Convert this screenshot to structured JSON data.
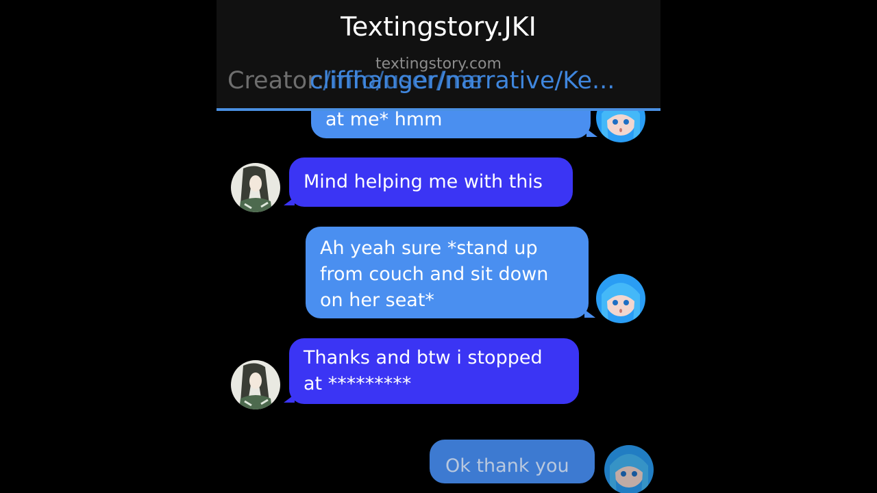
{
  "header": {
    "title": "Textingstory.JKI",
    "site": "textingstory.com",
    "creator_prefix": "Creator:",
    "overlay_path": "cliffhanger/narrative/Ke...",
    "overlay_fragment": "c/info/user/me"
  },
  "messages": [
    {
      "sender": "me",
      "text": "at me* hmm"
    },
    {
      "sender": "them",
      "text": "Mind helping me with this"
    },
    {
      "sender": "me",
      "text": "Ah yeah sure *stand up\nfrom couch and sit down\non her seat*"
    },
    {
      "sender": "them",
      "text": "Thanks and btw i stopped\nat *********"
    },
    {
      "sender": "me",
      "text": "Ok thank you"
    }
  ],
  "avatars": {
    "me": "blue-haired-girl-avatar",
    "them": "dark-haired-girl-avatar"
  },
  "colors": {
    "me_bubble": "#4a8ff0",
    "them_bubble": "#3b35f4",
    "header_bg": "#111111",
    "accent_line": "#4a90e2"
  }
}
